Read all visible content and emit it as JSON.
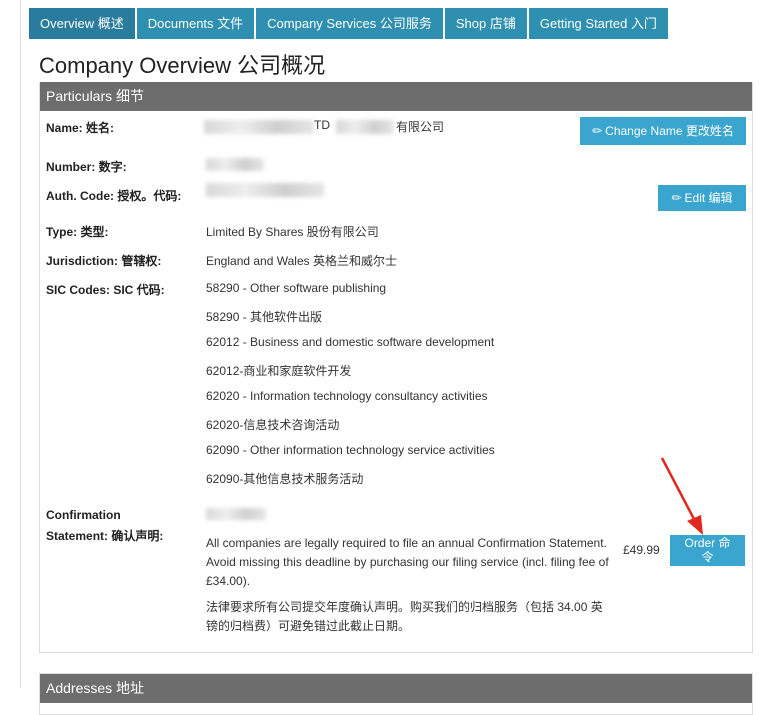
{
  "tabs": [
    {
      "label": "Overview 概述",
      "active": true
    },
    {
      "label": "Documents 文件",
      "active": false
    },
    {
      "label": "Company Services 公司服务",
      "active": false
    },
    {
      "label": "Shop 店铺",
      "active": false
    },
    {
      "label": "Getting Started 入门",
      "active": false
    }
  ],
  "page_title": "Company Overview 公司概况",
  "particulars": {
    "heading": "Particulars 细节",
    "name_label": "Name: 姓名:",
    "name_value_visible": "TD",
    "name_value_suffix": "有限公司",
    "change_name_button": "Change Name 更改姓名",
    "number_label": "Number: 数字:",
    "auth_code_label": "Auth. Code: 授权。代码:",
    "edit_button": "Edit  编辑",
    "type_label": "Type: 类型:",
    "type_value": "Limited By Shares 股份有限公司",
    "jurisdiction_label": "Jurisdiction: 管辖权:",
    "jurisdiction_value": "England and Wales 英格兰和威尔士",
    "sic_label": "SIC Codes:  SIC 代码:",
    "sic_codes": [
      "58290 - Other software publishing",
      "58290 - 其他软件出版",
      "62012 - Business and domestic software development",
      "62012-商业和家庭软件开发",
      "62020 - Information technology consultancy activities",
      "62020-信息技术咨询活动",
      "62090 - Other information technology service activities",
      "62090-其他信息技术服务活动"
    ],
    "confirmation_label_line1": "Confirmation",
    "confirmation_label_line2": "Statement: 确认声明:",
    "confirmation_text_en_1": "All companies are legally required to file an annual Confirmation Statement.",
    "confirmation_text_en_2": "Avoid missing this deadline by purchasing our filing service (incl. filing fee of",
    "confirmation_text_en_3": "£34.00).",
    "confirmation_text_cn_1": "法律要求所有公司提交年度确认声明。购买我们的归档服务（包括 34.00 英",
    "confirmation_text_cn_2": "镑的归档费）可避免错过此截止日期。",
    "price": "£49.99",
    "order_button_line1": "Order 命",
    "order_button_line2": "令"
  },
  "addresses": {
    "heading": "Addresses 地址"
  },
  "colors": {
    "tab_bg": "#2f8fb1",
    "button_bg": "#3aa6cf",
    "panel_header_bg": "#6d6d6d",
    "arrow_red": "#e0281e"
  },
  "icons": [
    "pencil-icon",
    "red-arrow-annotation"
  ]
}
